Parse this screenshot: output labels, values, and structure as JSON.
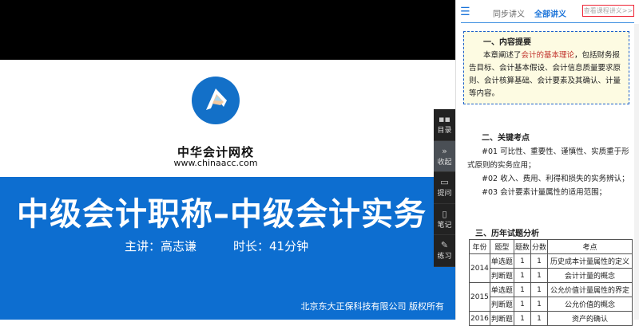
{
  "video": {
    "brand": "中华会计网校",
    "url": "www.chinaacc.com",
    "title": "中级会计职称–中级会计实务",
    "lecturer": "主讲：高志谦",
    "duration": "时长：41分钟",
    "copyright": "北京东大正保科技有限公司  版权所有",
    "colors": {
      "blue": "#0d6ed0",
      "accent": "#1a73d9"
    }
  },
  "sidetools": [
    {
      "label": "目录",
      "icon": "grid-icon"
    },
    {
      "label": "收起",
      "icon": "double-chevron-right-icon"
    },
    {
      "label": "提问",
      "icon": "chat-icon"
    },
    {
      "label": "笔记",
      "icon": "note-icon"
    },
    {
      "label": "练习",
      "icon": "edit-icon"
    }
  ],
  "panel": {
    "tabs": [
      "同步讲义",
      "全部讲义"
    ],
    "view_button": "查看课程讲义>>",
    "summary": {
      "heading": "一、内容提要",
      "pre": "本章阐述了",
      "highlight": "会计的基本理论",
      "post": "，包括财务报告目标、会计基本假设、会计信息质量要求原则、会计核算基础、会计要素及其确认、计量等内容。"
    },
    "keys": {
      "heading": "二、关键考点",
      "items": [
        "#01 可比性、重要性、谨慎性、实质重于形式原则的实务应用；",
        "#02 收入、费用、利得和损失的实务辨认；",
        "#03 会计要素计量属性的适用范围；"
      ]
    },
    "history": {
      "heading": "三、历年试题分析",
      "columns": [
        "年份",
        "题型",
        "题数",
        "分数",
        "考点"
      ],
      "rows": [
        {
          "year": "2014",
          "type": "单选题",
          "count": "1",
          "score": "1",
          "point": "历史成本计量属性的定义"
        },
        {
          "year": "",
          "type": "判断题",
          "count": "1",
          "score": "1",
          "point": "会计计量的概念"
        },
        {
          "year": "2015",
          "type": "单选题",
          "count": "1",
          "score": "1",
          "point": "公允价值计量属性的界定"
        },
        {
          "year": "",
          "type": "判断题",
          "count": "1",
          "score": "1",
          "point": "公允价值的概念"
        },
        {
          "year": "2016",
          "type": "判断题",
          "count": "1",
          "score": "1",
          "point": "资产的确认"
        }
      ]
    }
  }
}
